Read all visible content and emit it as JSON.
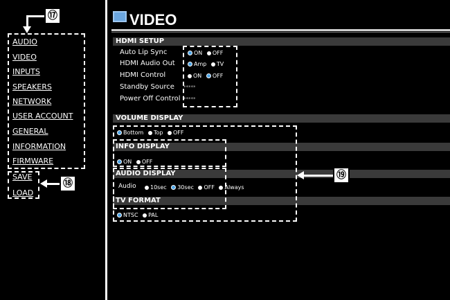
{
  "callouts": {
    "nav": "⑰",
    "actions": "⑱",
    "display": "⑲"
  },
  "sidebar": {
    "items": [
      {
        "label": "AUDIO"
      },
      {
        "label": "VIDEO"
      },
      {
        "label": "INPUTS"
      },
      {
        "label": "SPEAKERS"
      },
      {
        "label": "NETWORK"
      },
      {
        "label": "USER ACCOUNT"
      },
      {
        "label": "GENERAL"
      },
      {
        "label": "INFORMATION"
      },
      {
        "label": "FIRMWARE"
      }
    ],
    "actions": [
      {
        "label": "SAVE"
      },
      {
        "label": "LOAD"
      }
    ]
  },
  "page": {
    "title": "VIDEO"
  },
  "hdmi_setup": {
    "header": "HDMI SETUP",
    "rows": [
      {
        "label": "Auto Lip Sync",
        "options": [
          "ON",
          "OFF"
        ],
        "selected": "ON"
      },
      {
        "label": "HDMI Audio Out",
        "options": [
          "Amp",
          "TV"
        ],
        "selected": "Amp"
      },
      {
        "label": "HDMI Control",
        "options": [
          "ON",
          "OFF"
        ],
        "selected": "OFF"
      },
      {
        "label": "Standby Source",
        "value": "*****"
      },
      {
        "label": "Power Off Control",
        "value": "*****"
      }
    ]
  },
  "volume_display": {
    "header": "VOLUME DISPLAY",
    "options": [
      "Bottom",
      "Top",
      "OFF"
    ],
    "selected": "Bottom"
  },
  "info_display": {
    "header": "INFO DISPLAY",
    "options": [
      "ON",
      "OFF"
    ],
    "selected": "ON"
  },
  "audio_display": {
    "header": "AUDIO DISPLAY",
    "label": "Audio",
    "options": [
      "10sec",
      "30sec",
      "OFF",
      "Always"
    ],
    "selected": "30sec"
  },
  "tv_format": {
    "header": "TV FORMAT",
    "options": [
      "NTSC",
      "PAL"
    ],
    "selected": "NTSC"
  },
  "colors": {
    "selected_radio": "#4aa3e6",
    "section_bg": "#3a3a3a",
    "background": "#000000"
  }
}
